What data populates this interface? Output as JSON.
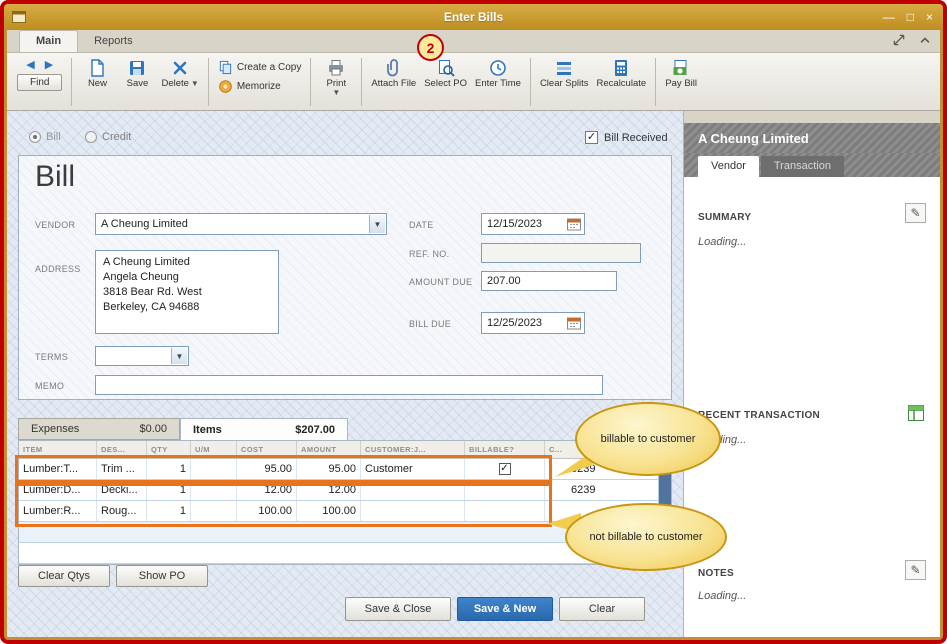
{
  "window": {
    "title": "Enter Bills",
    "controls": {
      "minimize": "—",
      "maximize": "□",
      "close": "×"
    }
  },
  "badge": {
    "number": "2"
  },
  "ribbon_tabs": {
    "main": "Main",
    "reports": "Reports"
  },
  "icons": {
    "back_arrow": "◀",
    "forward_arrow": "▶",
    "dropdown": "▼",
    "checkmark": "✓",
    "pencil": "✎"
  },
  "toolbar": {
    "find": "Find",
    "new": "New",
    "save": "Save",
    "delete": "Delete",
    "create_copy": "Create a Copy",
    "memorize": "Memorize",
    "print": "Print",
    "attach_file": "Attach File",
    "select_po": "Select PO",
    "enter_time": "Enter Time",
    "clear_splits": "Clear Splits",
    "recalculate": "Recalculate",
    "pay_bill": "Pay Bill"
  },
  "form": {
    "bill_radio": "Bill",
    "credit_radio": "Credit",
    "bill_received": "Bill Received",
    "heading": "Bill",
    "vendor": {
      "label": "VENDOR",
      "value": "A Cheung Limited"
    },
    "address": {
      "label": "ADDRESS",
      "line1": "A Cheung Limited",
      "line2": "Angela Cheung",
      "line3": "3818 Bear Rd. West",
      "line4": "Berkeley, CA 94688"
    },
    "date": {
      "label": "DATE",
      "value": "12/15/2023"
    },
    "ref_no": {
      "label": "REF. NO.",
      "value": ""
    },
    "amount_due": {
      "label": "AMOUNT DUE",
      "value": "207.00"
    },
    "bill_due": {
      "label": "BILL DUE",
      "value": "12/25/2023"
    },
    "terms": {
      "label": "TERMS",
      "value": ""
    },
    "memo": {
      "label": "MEMO",
      "value": ""
    }
  },
  "detail_tabs": {
    "expenses": {
      "label": "Expenses",
      "amount": "$0.00"
    },
    "items": {
      "label": "Items",
      "amount": "$207.00"
    }
  },
  "items_table": {
    "columns": [
      "ITEM",
      "DES...",
      "QTY",
      "U/M",
      "COST",
      "AMOUNT",
      "CUSTOMER:J...",
      "BILLABLE?",
      "C..."
    ],
    "rows": [
      {
        "item": "Lumber:T...",
        "desc": "Trim ...",
        "qty": "1",
        "um": "",
        "cost": "95.00",
        "amount": "95.00",
        "customer": "Customer",
        "billable": "✓",
        "c": "6239"
      },
      {
        "item": "Lumber:D...",
        "desc": "Decki...",
        "qty": "1",
        "um": "",
        "cost": "12.00",
        "amount": "12.00",
        "customer": "",
        "billable": "",
        "c": "6239"
      },
      {
        "item": "Lumber:R...",
        "desc": "Roug...",
        "qty": "1",
        "um": "",
        "cost": "100.00",
        "amount": "100.00",
        "customer": "",
        "billable": "",
        "c": ""
      }
    ]
  },
  "callouts": {
    "billable": "billable to customer",
    "not_billable": "not billable to customer"
  },
  "actions": {
    "clear_qtys": "Clear Qtys",
    "show_po": "Show PO",
    "save_close": "Save & Close",
    "save_new": "Save & New",
    "clear": "Clear"
  },
  "side_panel": {
    "title": "A Cheung Limited",
    "vendor_tab": "Vendor",
    "transaction_tab": "Transaction",
    "summary": {
      "label": "SUMMARY",
      "status": "Loading..."
    },
    "recent": {
      "label": "RECENT TRANSACTION",
      "status": "Loading..."
    },
    "notes": {
      "label": "NOTES",
      "status": "Loading..."
    }
  },
  "colors": {
    "titlebar_gold": "#C8951F",
    "accent_blue": "#2E75C0",
    "highlight_orange": "#E8731C",
    "callout_yellow": "#F5D75E",
    "annotation_red": "#C00000"
  }
}
